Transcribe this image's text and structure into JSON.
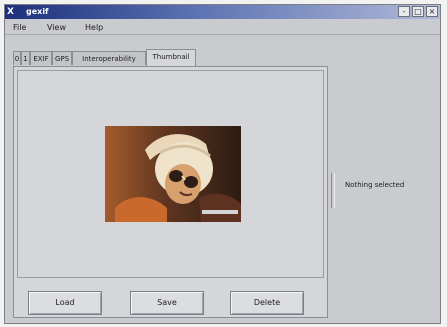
{
  "window": {
    "title": "gexif",
    "app_icon": "X",
    "controls": [
      "-",
      "□",
      "×"
    ]
  },
  "menu": {
    "items": [
      "File",
      "View",
      "Help"
    ]
  },
  "tabs": {
    "items": [
      "0",
      "1",
      "EXIF",
      "GPS",
      "Interoperability",
      "Thumbnail"
    ],
    "active": "Thumbnail"
  },
  "buttons": {
    "load": "Load",
    "save": "Save",
    "delete": "Delete"
  },
  "side_panel": {
    "status": "Nothing selected"
  },
  "icons": {
    "app": "x-window-icon",
    "minimize": "minimize-icon",
    "maximize": "maximize-icon",
    "close": "close-icon",
    "thumbnail": "photo-thumbnail-image"
  },
  "colors": {
    "titlebar_start": "#1c2f7c",
    "titlebar_end": "#b0b9d7",
    "background": "#c9cbcf"
  }
}
